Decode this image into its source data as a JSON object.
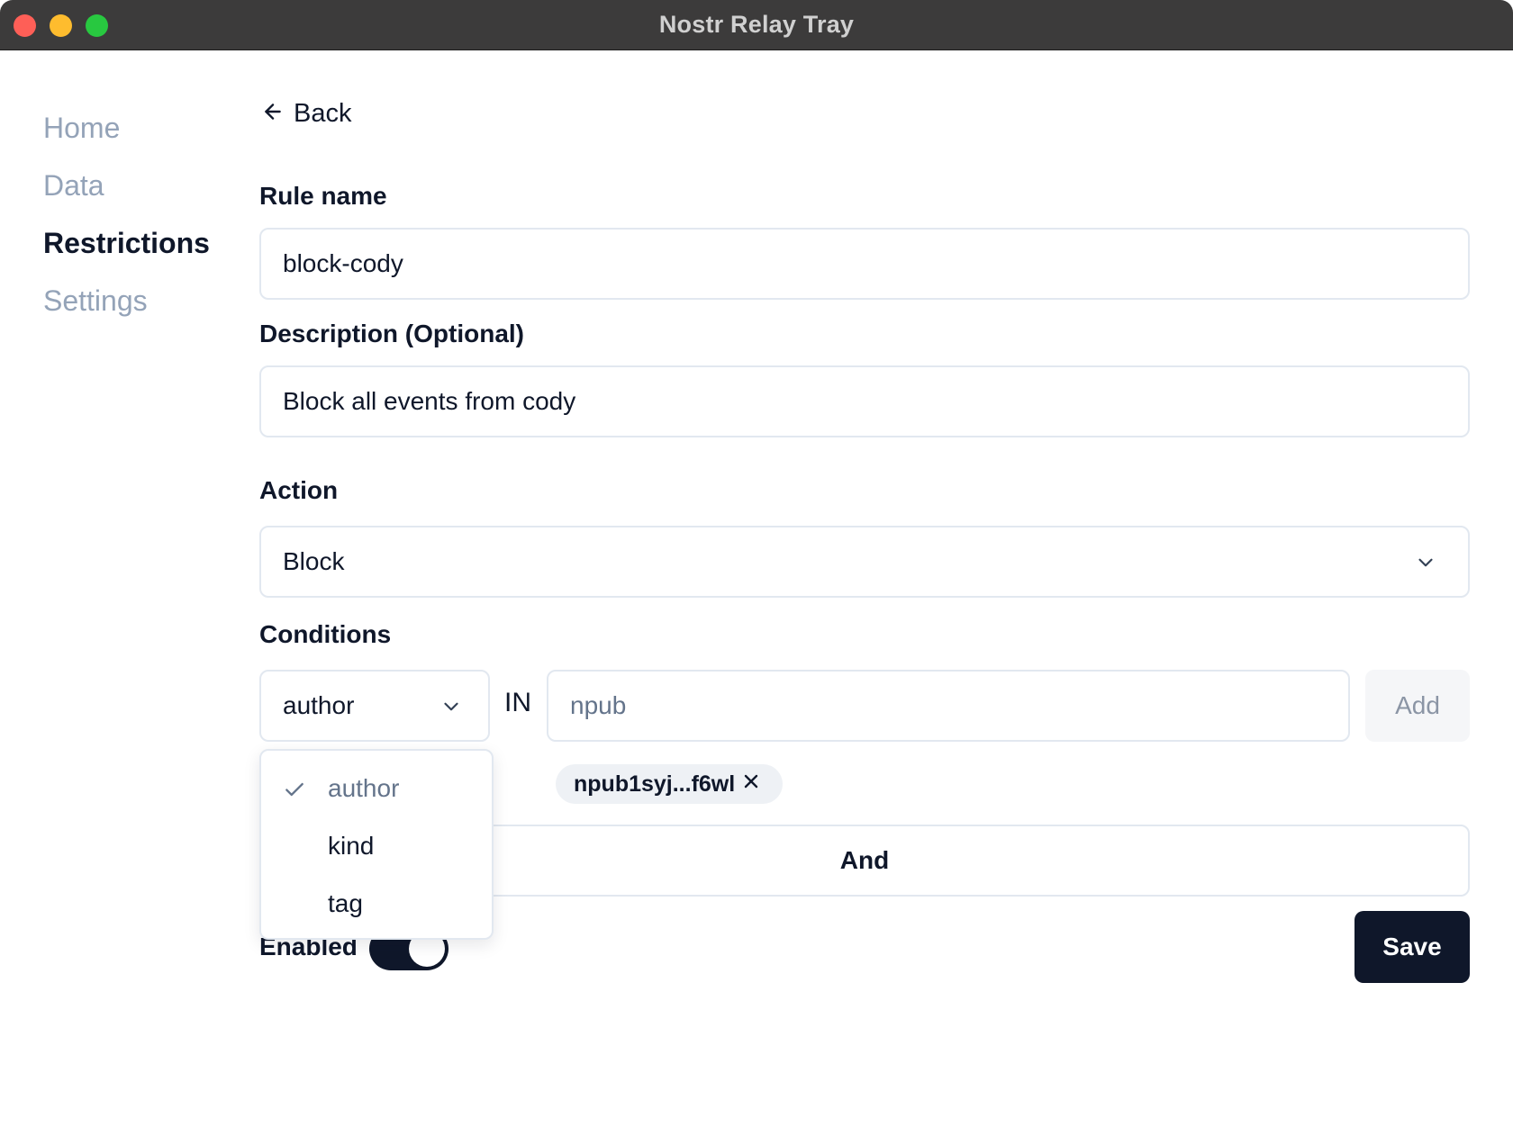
{
  "window": {
    "title": "Nostr Relay Tray"
  },
  "sidebar": {
    "items": [
      {
        "label": "Home"
      },
      {
        "label": "Data"
      },
      {
        "label": "Restrictions"
      },
      {
        "label": "Settings"
      }
    ],
    "active": "Restrictions"
  },
  "back": {
    "label": "Back"
  },
  "form": {
    "rule_name_label": "Rule name",
    "rule_name_value": "block-cody",
    "description_label": "Description (Optional)",
    "description_value": "Block all events from cody",
    "action_label": "Action",
    "action_value": "Block",
    "conditions_label": "Conditions",
    "condition_field_value": "author",
    "in_label": "IN",
    "npub_placeholder": "npub",
    "add_label": "Add",
    "chip_label": "npub1syj...f6wl",
    "and_label": "And",
    "enabled_label": "Enabled",
    "enabled": true,
    "save_label": "Save"
  },
  "dropdown": {
    "options": [
      {
        "label": "author",
        "selected": true
      },
      {
        "label": "kind",
        "selected": false
      },
      {
        "label": "tag",
        "selected": false
      }
    ]
  },
  "colors": {
    "accent": "#0f172a",
    "muted_text": "#94a3b8",
    "border": "#e2e8f0",
    "titlebar": "#3c3b3b"
  }
}
